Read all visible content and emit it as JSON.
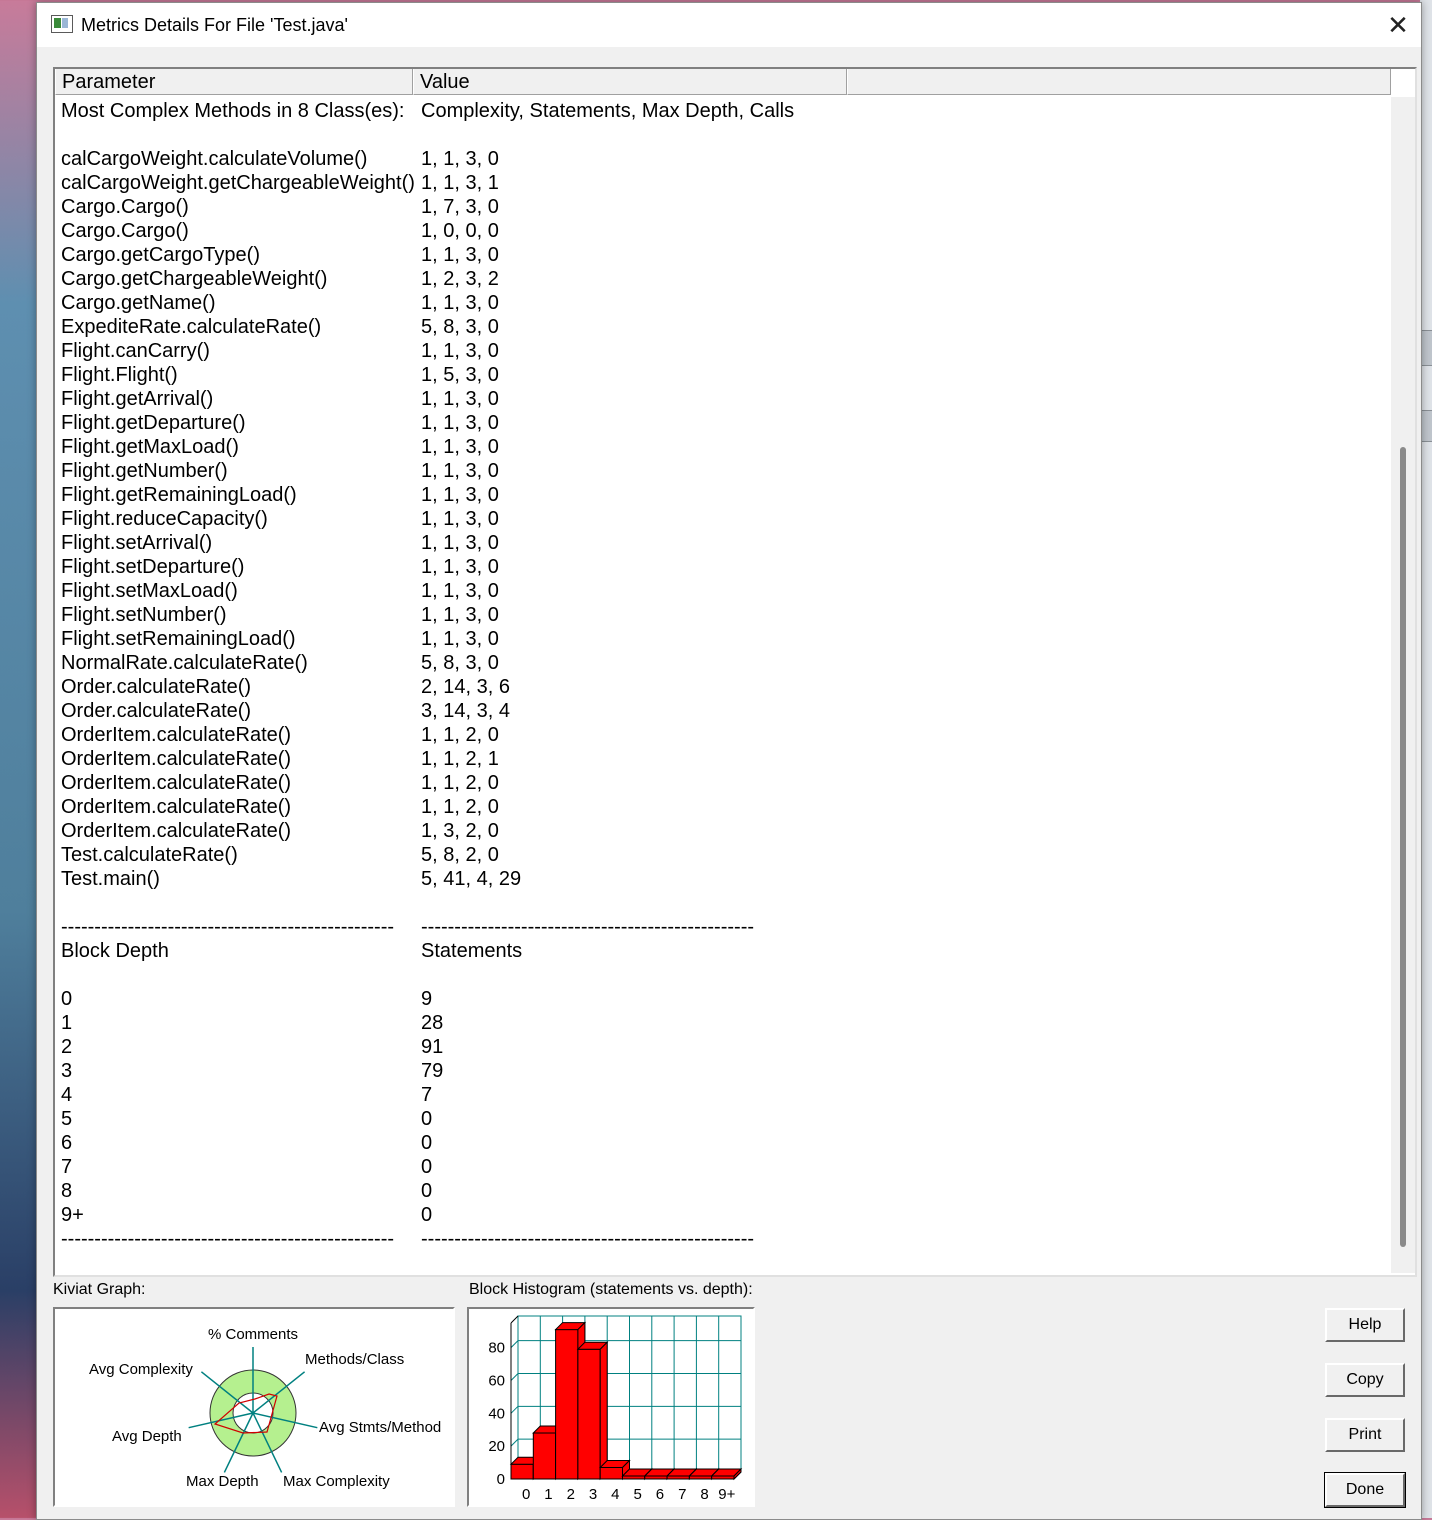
{
  "window": {
    "title": "Metrics Details For File 'Test.java'"
  },
  "table": {
    "headers": [
      "Parameter",
      "Value"
    ],
    "rows": [
      [
        "Most Complex Methods in 8 Class(es):",
        "Complexity, Statements, Max Depth, Calls"
      ],
      [
        "",
        ""
      ],
      [
        "calCargoWeight.calculateVolume()",
        "1, 1, 3, 0"
      ],
      [
        "calCargoWeight.getChargeableWeight()",
        "1, 1, 3, 1"
      ],
      [
        "Cargo.Cargo()",
        "1, 7, 3, 0"
      ],
      [
        "Cargo.Cargo()",
        "1, 0, 0, 0"
      ],
      [
        "Cargo.getCargoType()",
        "1, 1, 3, 0"
      ],
      [
        "Cargo.getChargeableWeight()",
        "1, 2, 3, 2"
      ],
      [
        "Cargo.getName()",
        "1, 1, 3, 0"
      ],
      [
        "ExpediteRate.calculateRate()",
        "5, 8, 3, 0"
      ],
      [
        "Flight.canCarry()",
        "1, 1, 3, 0"
      ],
      [
        "Flight.Flight()",
        "1, 5, 3, 0"
      ],
      [
        "Flight.getArrival()",
        "1, 1, 3, 0"
      ],
      [
        "Flight.getDeparture()",
        "1, 1, 3, 0"
      ],
      [
        "Flight.getMaxLoad()",
        "1, 1, 3, 0"
      ],
      [
        "Flight.getNumber()",
        "1, 1, 3, 0"
      ],
      [
        "Flight.getRemainingLoad()",
        "1, 1, 3, 0"
      ],
      [
        "Flight.reduceCapacity()",
        "1, 1, 3, 0"
      ],
      [
        "Flight.setArrival()",
        "1, 1, 3, 0"
      ],
      [
        "Flight.setDeparture()",
        "1, 1, 3, 0"
      ],
      [
        "Flight.setMaxLoad()",
        "1, 1, 3, 0"
      ],
      [
        "Flight.setNumber()",
        "1, 1, 3, 0"
      ],
      [
        "Flight.setRemainingLoad()",
        "1, 1, 3, 0"
      ],
      [
        "NormalRate.calculateRate()",
        "5, 8, 3, 0"
      ],
      [
        "Order.calculateRate()",
        "2, 14, 3, 6"
      ],
      [
        "Order.calculateRate()",
        "3, 14, 3, 4"
      ],
      [
        "OrderItem.calculateRate()",
        "1, 1, 2, 0"
      ],
      [
        "OrderItem.calculateRate()",
        "1, 1, 2, 1"
      ],
      [
        "OrderItem.calculateRate()",
        "1, 1, 2, 0"
      ],
      [
        "OrderItem.calculateRate()",
        "1, 1, 2, 0"
      ],
      [
        "OrderItem.calculateRate()",
        "1, 3, 2, 0"
      ],
      [
        "Test.calculateRate()",
        "5, 8, 2, 0"
      ],
      [
        "Test.main()",
        "5, 41, 4, 29"
      ],
      [
        "",
        ""
      ],
      [
        "--------------------------------------------------",
        "--------------------------------------------------"
      ],
      [
        "Block Depth",
        "Statements"
      ],
      [
        "",
        ""
      ],
      [
        "0",
        "9"
      ],
      [
        "1",
        "28"
      ],
      [
        "2",
        "91"
      ],
      [
        "3",
        "79"
      ],
      [
        "4",
        "7"
      ],
      [
        "5",
        "0"
      ],
      [
        "6",
        "0"
      ],
      [
        "7",
        "0"
      ],
      [
        "8",
        "0"
      ],
      [
        "9+",
        "0"
      ],
      [
        "--------------------------------------------------",
        "--------------------------------------------------"
      ]
    ]
  },
  "kiviat": {
    "label": "Kiviat Graph:",
    "axes": [
      "% Comments",
      "Methods/Class",
      "Avg Stmts/Method",
      "Max Complexity",
      "Max Depth",
      "Avg Depth",
      "Avg Complexity"
    ],
    "ring_color": "#b5f08f",
    "spoke_color": "#008080",
    "line_color": "#ff0000"
  },
  "histogram": {
    "label": "Block Histogram (statements vs. depth):",
    "bar_color": "#ff0000",
    "grid_color": "#008080"
  },
  "chart_data": {
    "type": "bar",
    "categories": [
      "0",
      "1",
      "2",
      "3",
      "4",
      "5",
      "6",
      "7",
      "8",
      "9+"
    ],
    "values": [
      9,
      28,
      91,
      79,
      7,
      0,
      0,
      0,
      0,
      0
    ],
    "y_ticks": [
      "0",
      "20",
      "40",
      "60",
      "80"
    ],
    "ylim": [
      0,
      95
    ],
    "grid": true
  },
  "buttons": {
    "help": "Help",
    "copy": "Copy",
    "print": "Print",
    "done": "Done"
  }
}
